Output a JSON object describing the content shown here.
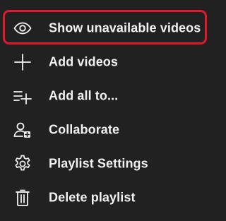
{
  "menu": {
    "highlight_color": "#e0192b",
    "text_color": "#f1f1f1",
    "background_color": "#212121",
    "items": [
      {
        "label": "Show unavailable videos",
        "icon": "eye-icon",
        "highlighted": true
      },
      {
        "label": "Add videos",
        "icon": "plus-icon"
      },
      {
        "label": "Add all to...",
        "icon": "add-to-list-icon"
      },
      {
        "label": "Collaborate",
        "icon": "add-person-icon"
      },
      {
        "label": "Playlist Settings",
        "icon": "gear-icon"
      },
      {
        "label": "Delete playlist",
        "icon": "trash-icon"
      }
    ]
  }
}
